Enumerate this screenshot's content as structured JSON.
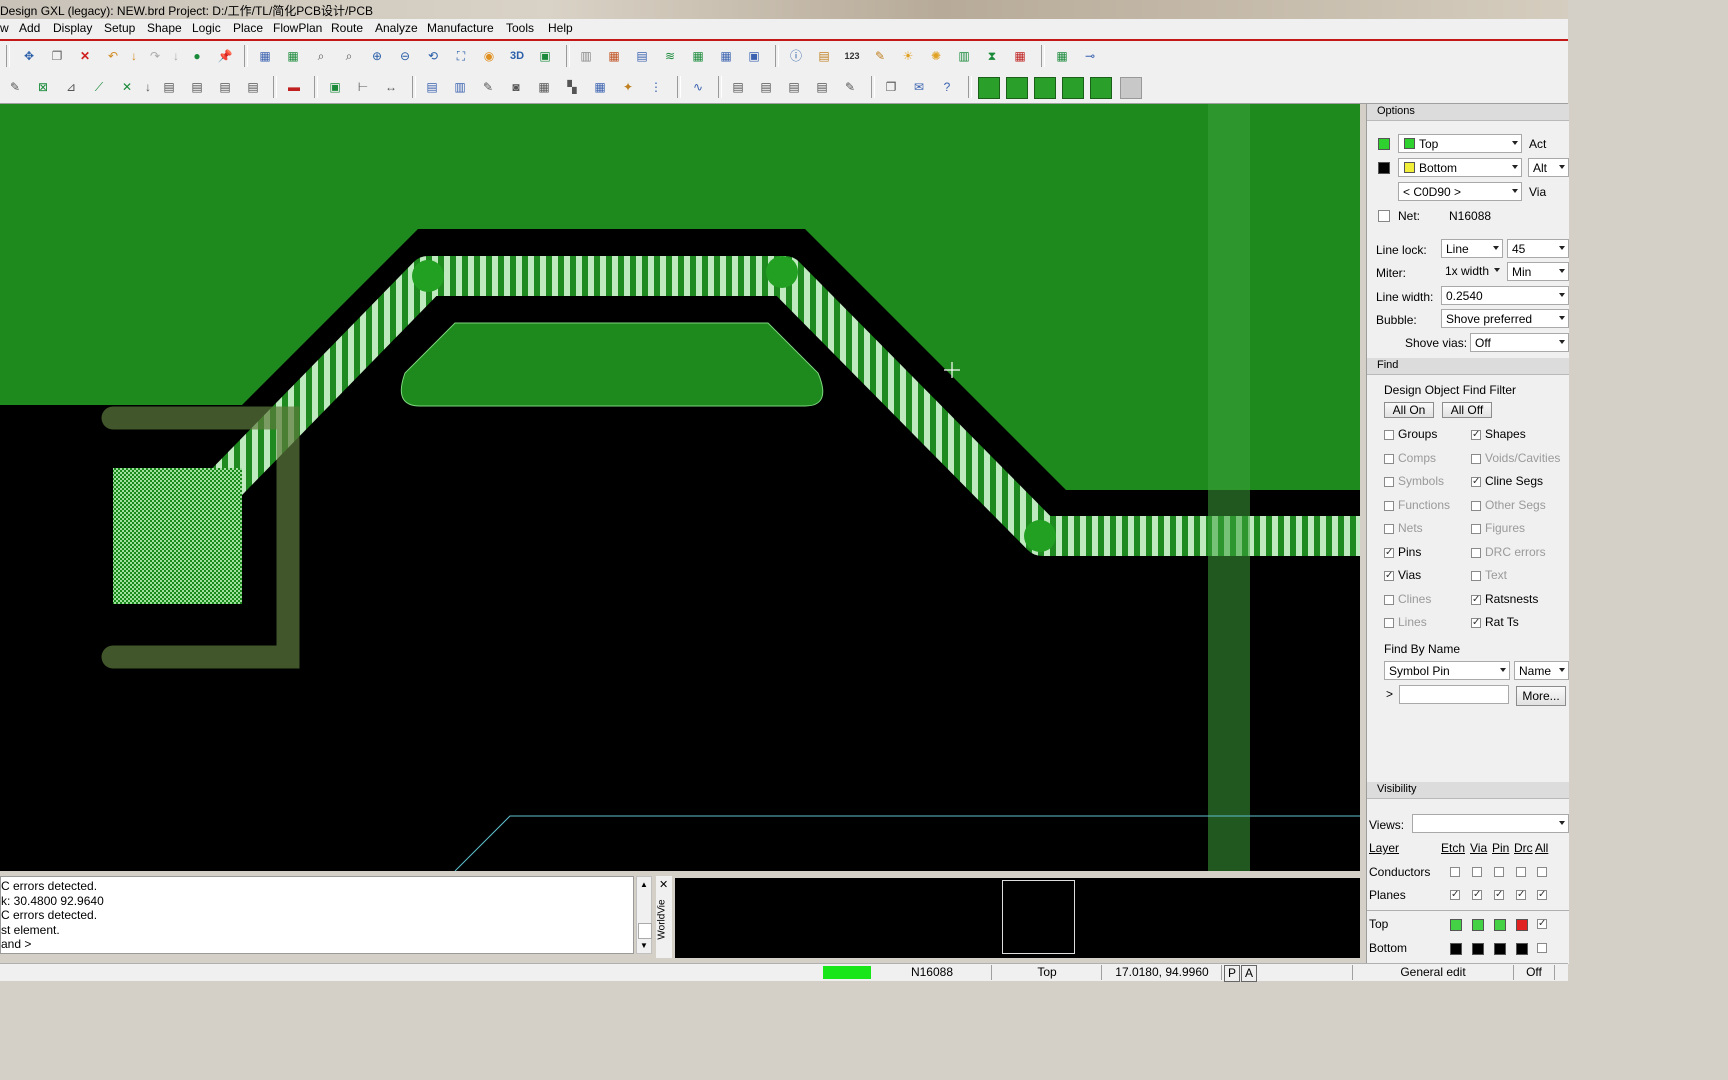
{
  "title": "Design GXL (legacy): NEW.brd  Project: D:/工作/TL/简化PCB设计/PCB",
  "menu": [
    "w",
    "Add",
    "Display",
    "Setup",
    "Shape",
    "Logic",
    "Place",
    "FlowPlan",
    "Route",
    "Analyze",
    "Manufacture",
    "Tools",
    "Help"
  ],
  "toolbar_icons": {
    "text_3d": "3D",
    "text_123": "123"
  },
  "options": {
    "header": "Options",
    "active_layer": "Top",
    "active_label": "Act",
    "alt_layer": "Bottom",
    "alt_label": "Alt",
    "via": "< C0D90 >",
    "via_label": "Via",
    "net_label": "Net:",
    "net_value": "N16088",
    "line_lock_label": "Line lock:",
    "line_lock_value": "Line",
    "line_lock_angle": "45",
    "miter_label": "Miter:",
    "miter_value": "1x width",
    "miter_min": "Min",
    "line_width_label": "Line width:",
    "line_width_value": "0.2540",
    "bubble_label": "Bubble:",
    "bubble_value": "Shove preferred",
    "shove_vias_label": "Shove vias:",
    "shove_vias_value": "Off",
    "colors": {
      "top": "#2fd12f",
      "bottom": "#f2ef3a"
    }
  },
  "find": {
    "header": "Find",
    "title": "Design Object Find Filter",
    "all_on": "All On",
    "all_off": "All Off",
    "left": [
      {
        "label": "Groups",
        "checked": false,
        "enabled": true
      },
      {
        "label": "Comps",
        "checked": false,
        "enabled": false
      },
      {
        "label": "Symbols",
        "checked": false,
        "enabled": false
      },
      {
        "label": "Functions",
        "checked": false,
        "enabled": false
      },
      {
        "label": "Nets",
        "checked": false,
        "enabled": false
      },
      {
        "label": "Pins",
        "checked": true,
        "enabled": true
      },
      {
        "label": "Vias",
        "checked": true,
        "enabled": true
      },
      {
        "label": "Clines",
        "checked": false,
        "enabled": false
      },
      {
        "label": "Lines",
        "checked": false,
        "enabled": false
      }
    ],
    "right": [
      {
        "label": "Shapes",
        "checked": true,
        "enabled": true
      },
      {
        "label": "Voids/Cavities",
        "checked": false,
        "enabled": false
      },
      {
        "label": "Cline Segs",
        "checked": true,
        "enabled": true
      },
      {
        "label": "Other Segs",
        "checked": false,
        "enabled": false
      },
      {
        "label": "Figures",
        "checked": false,
        "enabled": false
      },
      {
        "label": "DRC errors",
        "checked": false,
        "enabled": false
      },
      {
        "label": "Text",
        "checked": false,
        "enabled": false
      },
      {
        "label": "Ratsnests",
        "checked": true,
        "enabled": true
      },
      {
        "label": "Rat Ts",
        "checked": true,
        "enabled": true
      }
    ],
    "find_by_name": "Find By Name",
    "type_value": "Symbol Pin",
    "name_value": "Name",
    "prompt": ">",
    "input_value": "",
    "more": "More..."
  },
  "visibility": {
    "header": "Visibility",
    "views_label": "Views:",
    "views_value": "",
    "layer_label": "Layer",
    "cols": [
      "Etch",
      "Via",
      "Pin",
      "Drc",
      "All"
    ],
    "rows": [
      {
        "label": "Conductors",
        "checks": [
          false,
          false,
          false,
          false,
          false
        ]
      },
      {
        "label": "Planes",
        "checks": [
          true,
          true,
          true,
          true,
          true
        ]
      },
      {
        "label": "Top",
        "checks": [
          true,
          true,
          true,
          true,
          true
        ]
      },
      {
        "label": "Bottom",
        "checks": [
          false,
          false,
          false,
          false,
          false
        ]
      }
    ],
    "top_colors": [
      "#45d145",
      "#45d145",
      "#45d145",
      "#e02222"
    ],
    "bottom_colors": [
      "#000000",
      "#000000",
      "#000000",
      "#000000"
    ]
  },
  "console": [
    "C errors detected.",
    "k:  30.4800  92.9640",
    "C errors detected.",
    "st element.",
    "and >"
  ],
  "worldview_label": "WorldVie",
  "status": {
    "net": "N16088",
    "layer": "Top",
    "coords": "17.0180, 94.9960",
    "p": "P",
    "a": "A",
    "mode": "General edit",
    "off": "Off"
  }
}
